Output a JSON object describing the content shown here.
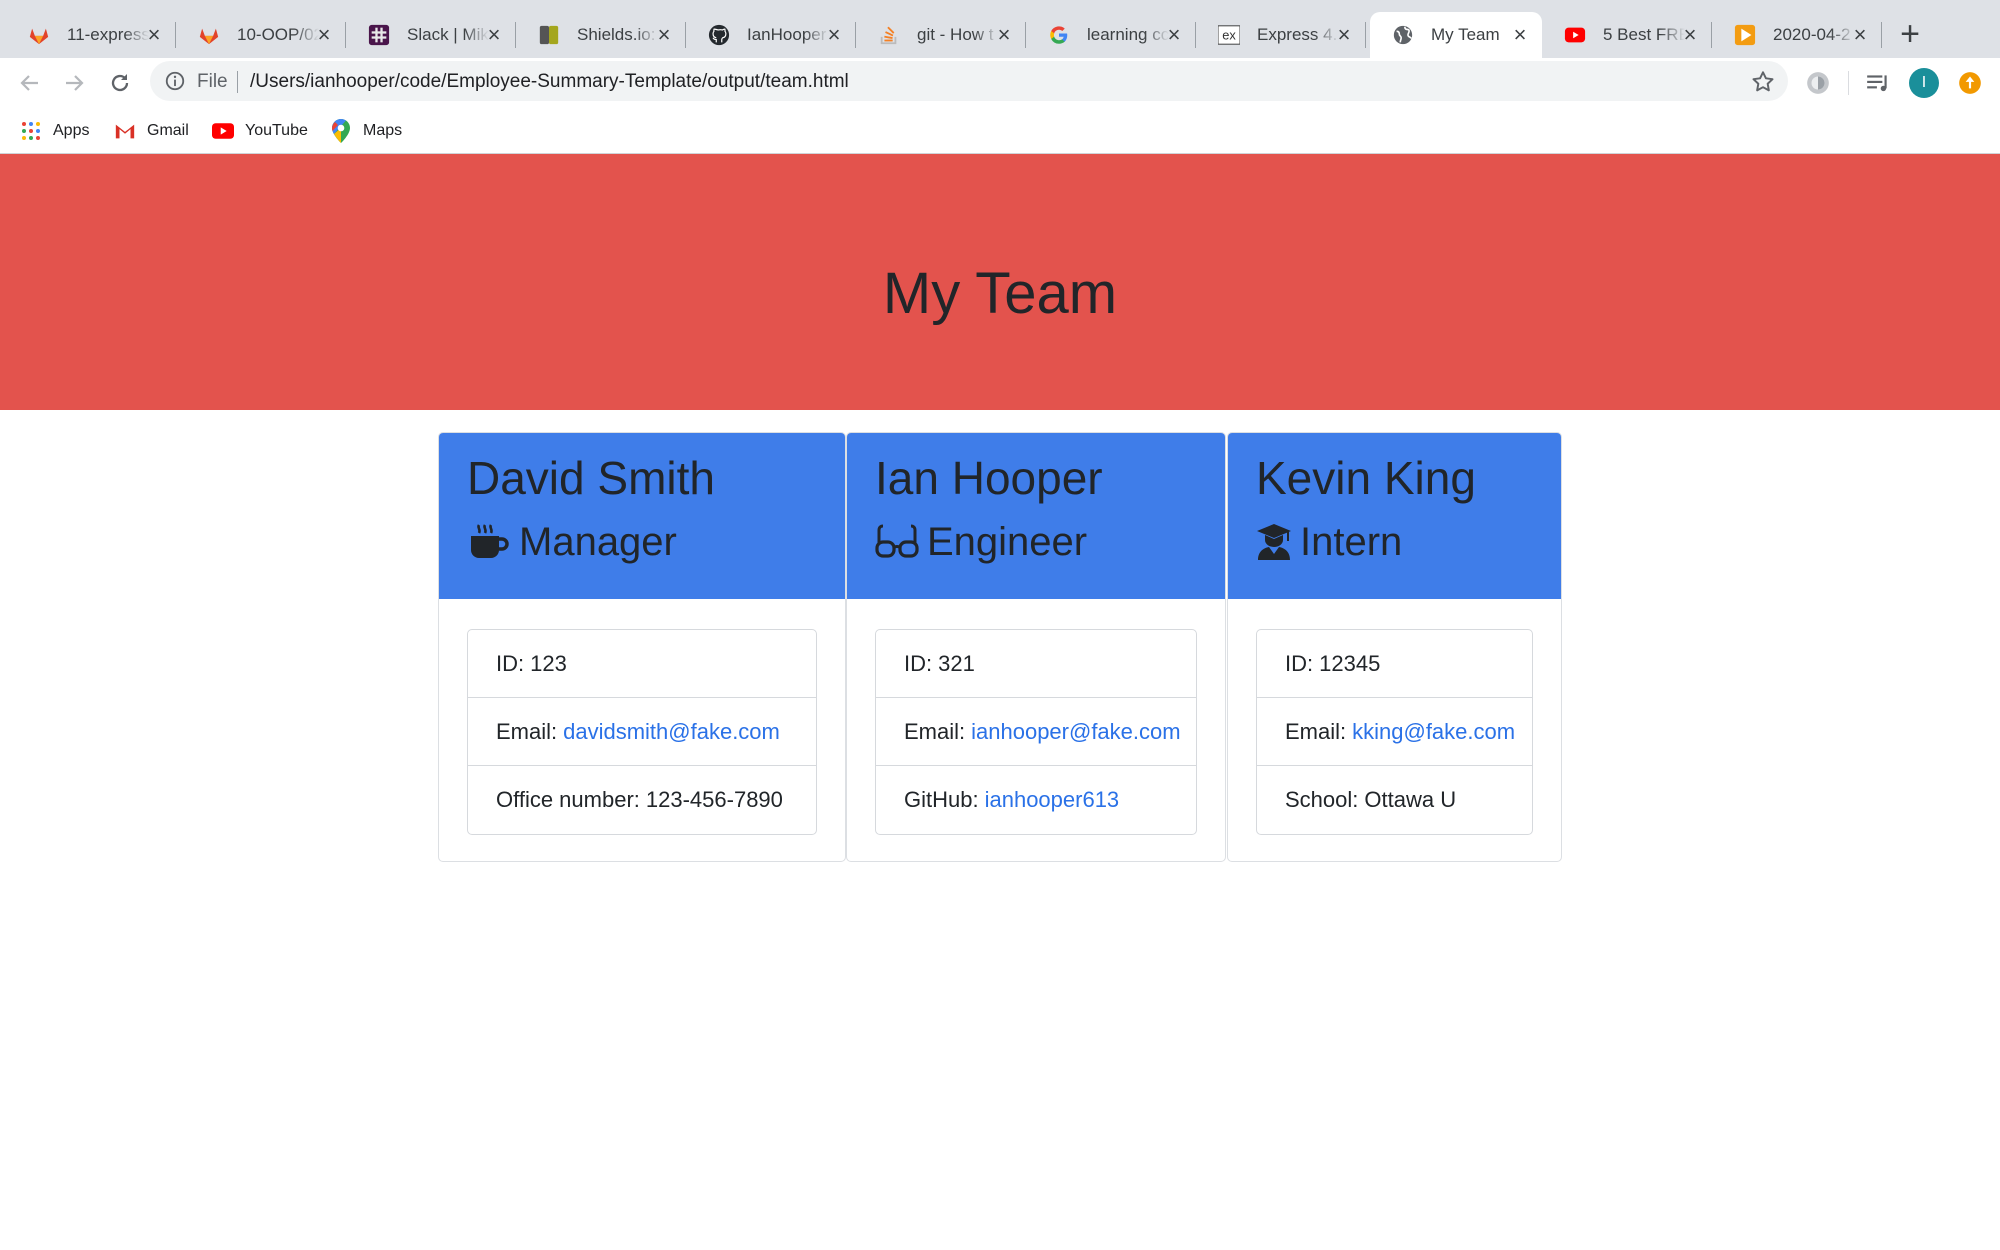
{
  "browser": {
    "tabs": [
      {
        "title": "11-express",
        "favicon": "gitlab-icon",
        "active": false
      },
      {
        "title": "10-OOP/02",
        "favicon": "gitlab-icon",
        "active": false
      },
      {
        "title": "Slack | Mik",
        "favicon": "slack-icon",
        "active": false
      },
      {
        "title": "Shields.io:",
        "favicon": "shields-icon",
        "active": false
      },
      {
        "title": "IanHooper",
        "favicon": "github-icon",
        "active": false
      },
      {
        "title": "git - How t",
        "favicon": "stackoverflow-icon",
        "active": false
      },
      {
        "title": "learning cc",
        "favicon": "google-icon",
        "active": false
      },
      {
        "title": "Express 4.",
        "favicon": "express-icon",
        "active": false
      },
      {
        "title": "My Team",
        "favicon": "globe-icon",
        "active": true
      },
      {
        "title": "5 Best FRE",
        "favicon": "youtube-icon",
        "active": false
      },
      {
        "title": "2020-04-2",
        "favicon": "media-play-icon",
        "active": false
      }
    ],
    "address_bar": {
      "scheme_label": "File",
      "url": "/Users/ianhooper/code/Employee-Summary-Template/output/team.html"
    },
    "profile_initial": "I",
    "bookmarks": [
      {
        "label": "Apps",
        "icon": "apps-grid-icon"
      },
      {
        "label": "Gmail",
        "icon": "gmail-icon"
      },
      {
        "label": "YouTube",
        "icon": "youtube-icon"
      },
      {
        "label": "Maps",
        "icon": "maps-pin-icon"
      }
    ]
  },
  "page": {
    "title": "My Team",
    "header_color": "#e3534d",
    "card_header_color": "#3f7de9",
    "link_color": "#2a71e7",
    "employees": [
      {
        "name": "David Smith",
        "role": "Manager",
        "role_icon": "coffee-mug-icon",
        "id_label": "ID:",
        "id": "123",
        "email_label": "Email:",
        "email": "davidsmith@fake.com",
        "extra_label": "Office number:",
        "extra_value": "123-456-7890"
      },
      {
        "name": "Ian Hooper",
        "role": "Engineer",
        "role_icon": "glasses-icon",
        "id_label": "ID:",
        "id": "321",
        "email_label": "Email:",
        "email": "ianhooper@fake.com",
        "extra_label": "GitHub:",
        "extra_value": "ianhooper613"
      },
      {
        "name": "Kevin King",
        "role": "Intern",
        "role_icon": "graduate-icon",
        "id_label": "ID:",
        "id": "12345",
        "email_label": "Email:",
        "email": "kking@fake.com",
        "extra_label": "School:",
        "extra_value": "Ottawa U"
      }
    ]
  }
}
